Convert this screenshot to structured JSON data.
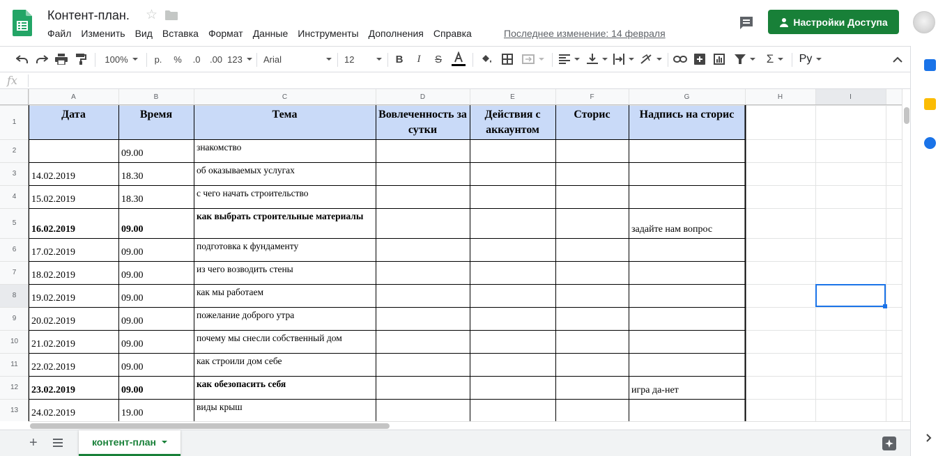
{
  "app": {
    "title": "Контент-план.",
    "last_edit": "Последнее изменение: 14 февраля",
    "share_label": "Настройки Доступа",
    "accent_color": "#188038"
  },
  "menu": [
    "Файл",
    "Изменить",
    "Вид",
    "Вставка",
    "Формат",
    "Данные",
    "Инструменты",
    "Дополнения",
    "Справка"
  ],
  "toolbar": {
    "zoom": "100%",
    "currency": "р.",
    "percent": "%",
    "decimal_less": ".0",
    "decimal_more": ".00",
    "format_more": "123",
    "font": "Arial",
    "font_size": "12",
    "input_language": "Ру"
  },
  "formula_bar": {
    "fx": "fx"
  },
  "columns": [
    "A",
    "B",
    "C",
    "D",
    "E",
    "F",
    "G",
    "H",
    "I"
  ],
  "rows": [
    "1",
    "2",
    "3",
    "4",
    "5",
    "6",
    "7",
    "8",
    "9",
    "10",
    "11",
    "12",
    "13"
  ],
  "table": {
    "headers": [
      "Дата",
      "Время",
      "Тема",
      "Вовлеченность за сутки",
      "Действия с аккаунтом",
      "Сторис",
      "Надпись на сторис"
    ],
    "rows": [
      {
        "date": "",
        "time": "09.00",
        "topic": "знакомство",
        "caption": "",
        "bold": false
      },
      {
        "date": "14.02.2019",
        "time": "18.30",
        "topic": "об оказываемых услугах",
        "caption": "",
        "bold": false
      },
      {
        "date": "15.02.2019",
        "time": "18.30",
        "topic": "с чего начать строительство",
        "caption": "",
        "bold": false
      },
      {
        "date": "16.02.2019",
        "time": "09.00",
        "topic": "как выбрать строительные материалы",
        "caption": "задайте нам вопрос",
        "bold": true
      },
      {
        "date": "17.02.2019",
        "time": "09.00",
        "topic": "подготовка к фундаменту",
        "caption": "",
        "bold": false
      },
      {
        "date": "18.02.2019",
        "time": "09.00",
        "topic": "из чего возводить стены",
        "caption": "",
        "bold": false
      },
      {
        "date": "19.02.2019",
        "time": "09.00",
        "topic": "как мы работаем",
        "caption": "",
        "bold": false
      },
      {
        "date": "20.02.2019",
        "time": "09.00",
        "topic": "пожелание доброго утра",
        "caption": "",
        "bold": false
      },
      {
        "date": "21.02.2019",
        "time": "09.00",
        "topic": "почему мы снесли собственный дом",
        "caption": "",
        "bold": false
      },
      {
        "date": "22.02.2019",
        "time": "09.00",
        "topic": "как строили дом себе",
        "caption": "",
        "bold": false
      },
      {
        "date": "23.02.2019",
        "time": "09.00",
        "topic": "как обезопасить себя",
        "caption": "игра да-нет",
        "bold": true
      },
      {
        "date": "24.02.2019",
        "time": "19.00",
        "topic": "виды крыш",
        "caption": "",
        "bold": false
      }
    ]
  },
  "sheet_tab": {
    "label": "контент-план"
  },
  "colors": {
    "header_fill": "#c9daf8",
    "selection": "#1a73e8"
  }
}
